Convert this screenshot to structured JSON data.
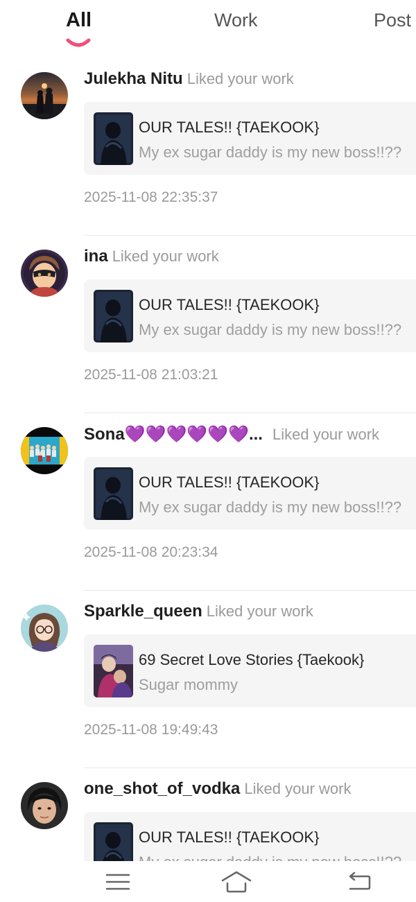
{
  "tabs": [
    {
      "label": "All",
      "active": true
    },
    {
      "label": "Work",
      "active": false
    },
    {
      "label": "Post",
      "active": false
    }
  ],
  "colors": {
    "accent": "#f0507a",
    "card_bg": "#f5f5f5",
    "muted_text": "#9a9a9a"
  },
  "notifications": [
    {
      "user": "Julekha Nitu",
      "action": "Liked your work",
      "avatar_icon": "sunset-couple-avatar",
      "work_title": "OUR TALES!! {TAEKOOK}",
      "work_subtitle": "My ex sugar daddy is my new boss!!??",
      "timestamp": "2025-11-08 22:35:37"
    },
    {
      "user": "ina",
      "action": "Liked your work",
      "avatar_icon": "masked-anime-avatar",
      "work_title": "OUR TALES!! {TAEKOOK}",
      "work_subtitle": "My ex sugar daddy is my new boss!!??",
      "timestamp": "2025-11-08 21:03:21"
    },
    {
      "user": "Sona💜💜💜💜💜💜...",
      "action": "Liked your work",
      "avatar_icon": "group-photo-avatar",
      "work_title": "OUR TALES!! {TAEKOOK}",
      "work_subtitle": "My ex sugar daddy is my new boss!!??",
      "timestamp": "2025-11-08 20:23:34"
    },
    {
      "user": "Sparkle_queen",
      "action": "Liked your work",
      "avatar_icon": "anime-girl-glasses-avatar",
      "work_title": "69 Secret Love Stories {Taekook}",
      "work_subtitle": "Sugar mommy",
      "timestamp": "2025-11-08 19:49:43"
    },
    {
      "user": "one_shot_of_vodka",
      "action": "Liked your work",
      "avatar_icon": "portrait-avatar",
      "work_title": "OUR TALES!! {TAEKOOK}",
      "work_subtitle": "My ex sugar daddy is my new boss!!??",
      "timestamp": ""
    }
  ],
  "bottom_nav": [
    {
      "icon": "menu-icon"
    },
    {
      "icon": "home-icon"
    },
    {
      "icon": "back-icon"
    }
  ]
}
